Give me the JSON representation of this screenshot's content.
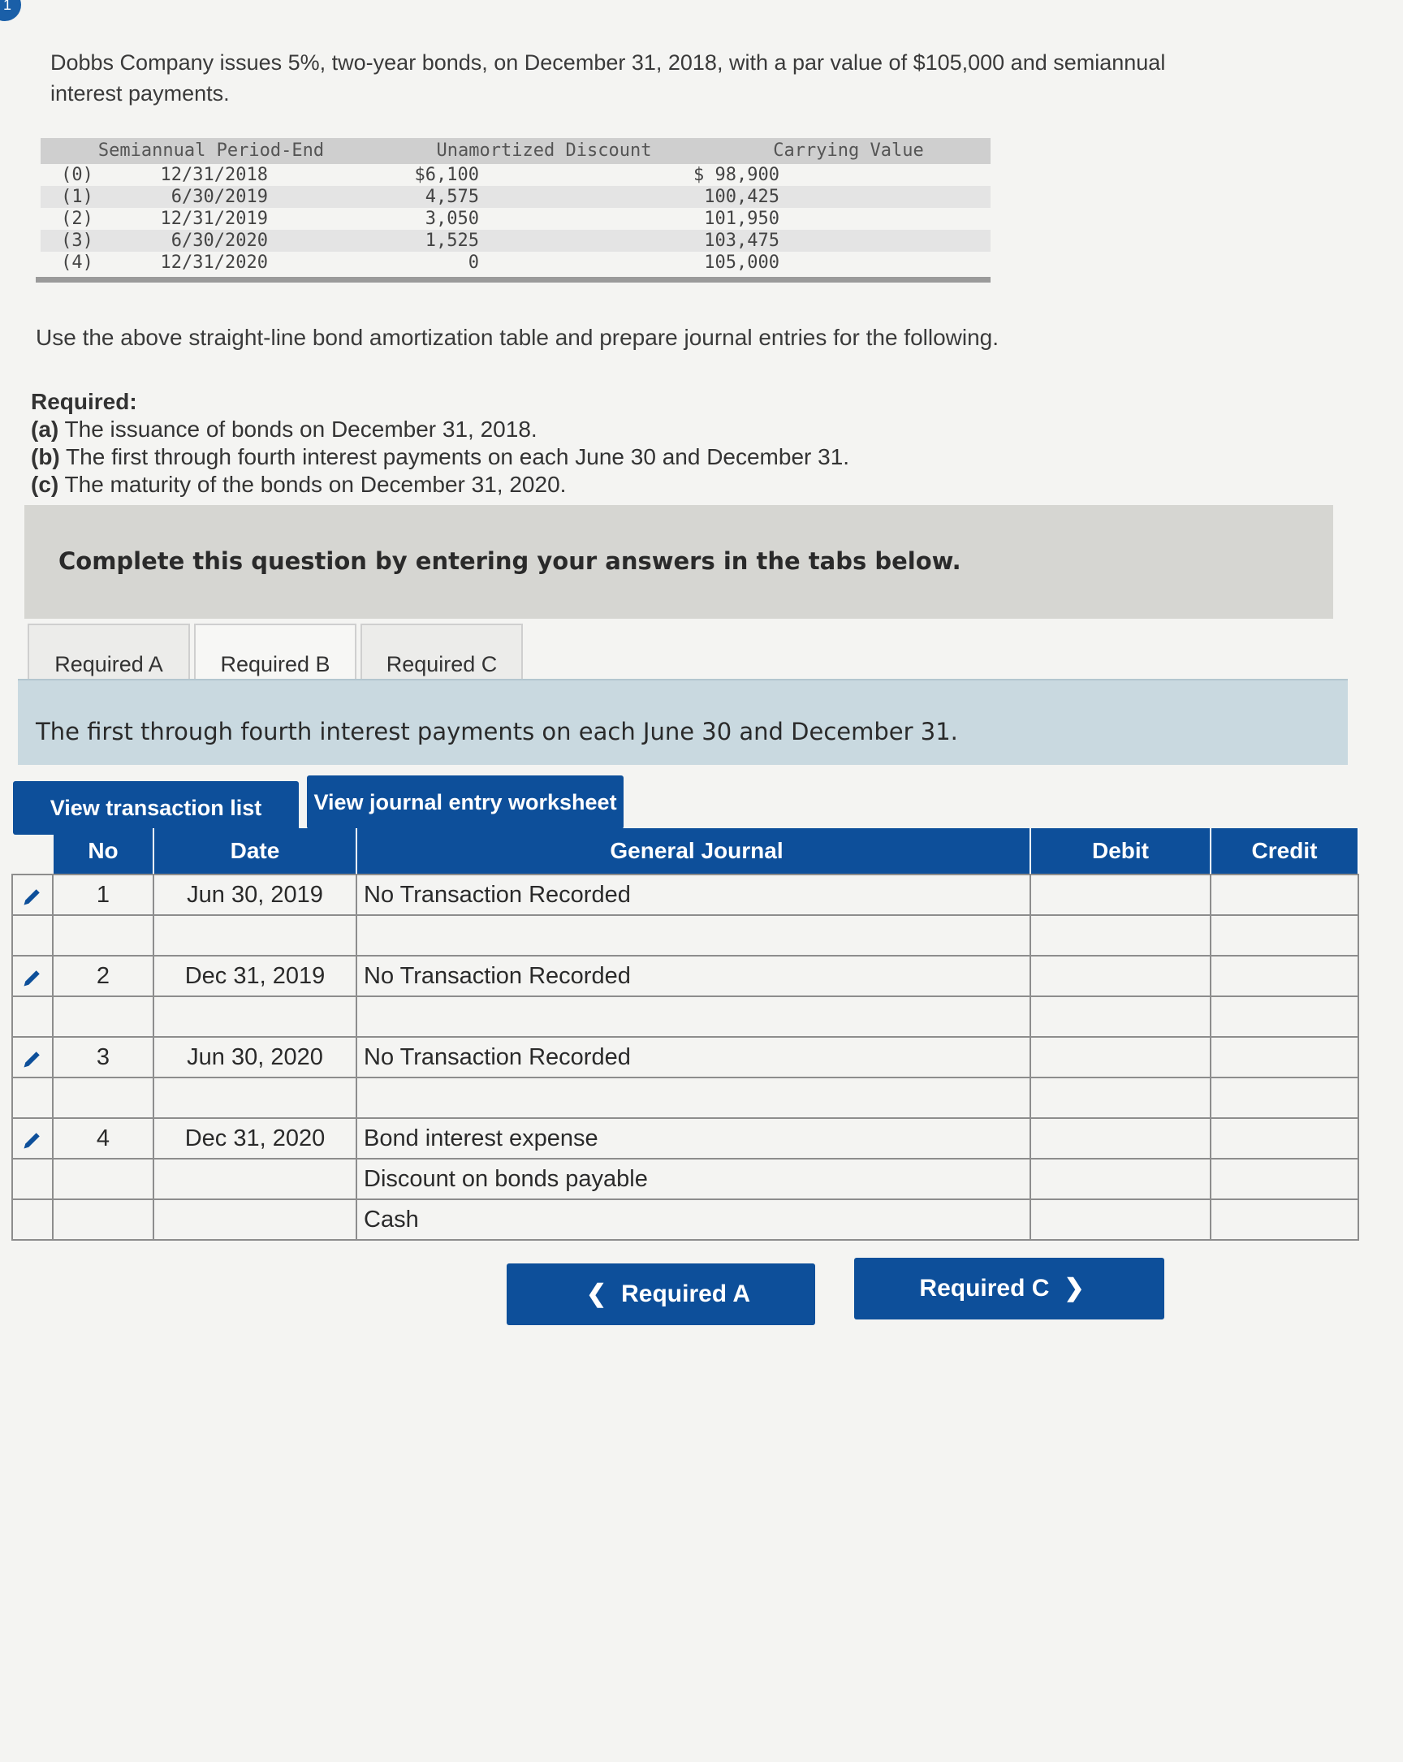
{
  "corner_badge": "1",
  "problem": {
    "intro": "Dobbs Company issues 5%, two-year bonds, on December 31, 2018, with a par value of $105,000 and semiannual interest payments.",
    "instruction": "Use the above straight-line bond amortization table and prepare journal entries for the following.",
    "required_label": "Required:",
    "required_items": [
      {
        "letter": "(a)",
        "text": "The issuance of bonds on December 31, 2018."
      },
      {
        "letter": "(b)",
        "text": "The first through fourth interest payments on each June 30 and December 31."
      },
      {
        "letter": "(c)",
        "text": "The maturity of the bonds on December 31, 2020."
      }
    ]
  },
  "amortization_table": {
    "headers": [
      "Semiannual Period-End",
      "Unamortized Discount",
      "Carrying Value"
    ],
    "rows": [
      {
        "idx": "(0)",
        "date": "12/31/2018",
        "discount": "$6,100",
        "carrying": "$ 98,900"
      },
      {
        "idx": "(1)",
        "date": "6/30/2019",
        "discount": "4,575",
        "carrying": "100,425"
      },
      {
        "idx": "(2)",
        "date": "12/31/2019",
        "discount": "3,050",
        "carrying": "101,950"
      },
      {
        "idx": "(3)",
        "date": "6/30/2020",
        "discount": "1,525",
        "carrying": "103,475"
      },
      {
        "idx": "(4)",
        "date": "12/31/2020",
        "discount": "0",
        "carrying": "105,000"
      }
    ]
  },
  "banner": "Complete this question by entering your answers in the tabs below.",
  "tabs": [
    {
      "label": "Required A"
    },
    {
      "label": "Required B"
    },
    {
      "label": "Required C"
    }
  ],
  "active_tab_description": "The first through fourth interest payments on each June 30 and December 31.",
  "buttons": {
    "view_transaction_list": "View transaction list",
    "view_journal_worksheet": "View journal entry worksheet"
  },
  "journal": {
    "headers": {
      "no": "No",
      "date": "Date",
      "account": "General Journal",
      "debit": "Debit",
      "credit": "Credit"
    },
    "rows": [
      {
        "no": "1",
        "date": "Jun 30, 2019",
        "account": "No Transaction Recorded",
        "debit": "",
        "credit": ""
      },
      {
        "no": "",
        "date": "",
        "account": "",
        "debit": "",
        "credit": ""
      },
      {
        "no": "2",
        "date": "Dec 31, 2019",
        "account": "No Transaction Recorded",
        "debit": "",
        "credit": ""
      },
      {
        "no": "",
        "date": "",
        "account": "",
        "debit": "",
        "credit": ""
      },
      {
        "no": "3",
        "date": "Jun 30, 2020",
        "account": "No Transaction Recorded",
        "debit": "",
        "credit": ""
      },
      {
        "no": "",
        "date": "",
        "account": "",
        "debit": "",
        "credit": ""
      },
      {
        "no": "4",
        "date": "Dec 31, 2020",
        "account": "Bond interest expense",
        "debit": "",
        "credit": ""
      },
      {
        "no": "",
        "date": "",
        "account": "Discount on bonds payable",
        "debit": "",
        "credit": ""
      },
      {
        "no": "",
        "date": "",
        "account": "Cash",
        "debit": "",
        "credit": ""
      }
    ]
  },
  "nav": {
    "prev": "Required A",
    "next": "Required C"
  },
  "colors": {
    "primary_blue": "#0d4f9a",
    "panel_blue": "#c9d9e0",
    "banner_gray": "#d6d6d2"
  }
}
